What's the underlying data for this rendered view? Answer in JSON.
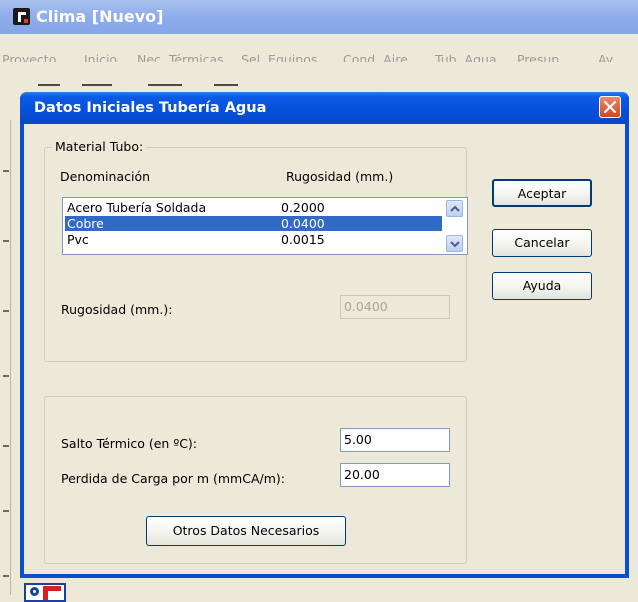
{
  "app": {
    "title": "Clima [Nuevo]",
    "menu": [
      "Proyecto",
      "Inicio",
      "Nec. Térmicas",
      "Sel. Equipos",
      "Cond. Aire",
      "Tub. Agua",
      "Presup.",
      "Ay"
    ]
  },
  "dialog": {
    "title": "Datos Iniciales Tubería Agua",
    "material_group": {
      "legend": "Material Tubo:",
      "col_name": "Denominación",
      "col_rough": "Rugosidad (mm.)",
      "rows": [
        {
          "name": "Acero Tubería Soldada",
          "rough": "0.2000"
        },
        {
          "name": "Cobre",
          "rough": "0.0400"
        },
        {
          "name": "Pvc",
          "rough": "0.0015"
        }
      ],
      "selected_index": 1,
      "rough_label": "Rugosidad (mm.):",
      "rough_value": "0.0400"
    },
    "params_group": {
      "salto_label": "Salto Térmico (en ºC):",
      "salto_value": "5.00",
      "perdida_label": "Perdida de Carga por m (mmCA/m):",
      "perdida_value": "20.00",
      "otros_button": "Otros Datos Necesarios"
    },
    "buttons": {
      "accept": "Aceptar",
      "cancel": "Cancelar",
      "help": "Ayuda"
    }
  },
  "colors": {
    "title_bar": "#0650d8",
    "selection": "#316ac5",
    "dialog_bg": "#ece9d8"
  },
  "icons": [
    "app-icon",
    "close-icon",
    "scroll-up-icon",
    "scroll-down-icon",
    "app-logo-icon"
  ]
}
